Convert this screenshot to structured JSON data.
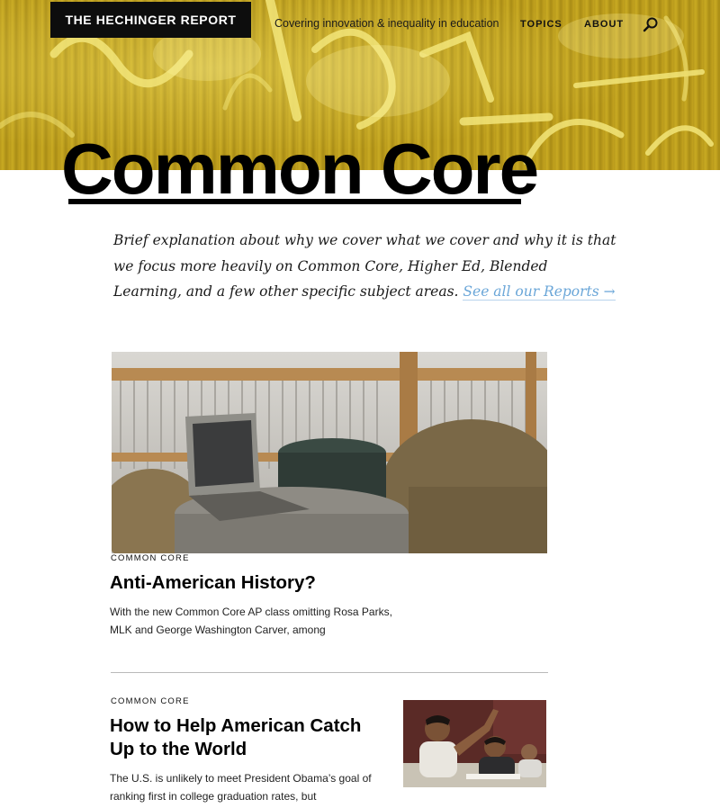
{
  "header": {
    "brand": "THE HECHINGER REPORT",
    "tagline": "Covering innovation & inequality in education",
    "nav": {
      "topics": "TOPICS",
      "about": "ABOUT"
    },
    "search_icon": "search-icon",
    "hero_color": "#c3a31e"
  },
  "page": {
    "title": "Common Core",
    "intro": "Brief explanation about why we cover what we cover and why it is that we focus more heavily on Common Core, Higher Ed, Blended Learning, and a few other specific subject areas.",
    "see_all_link": "See all our Reports →",
    "link_color": "#6aa6d8"
  },
  "articles": [
    {
      "kicker": "COMMON CORE",
      "headline": "Anti-American History?",
      "excerpt": "With the new Common Core AP class omitting Rosa Parks, MLK and George Washington Carver, among"
    },
    {
      "kicker": "COMMON CORE",
      "headline": "How to Help American Catch Up to the World",
      "excerpt": "The U.S. is unlikely to meet President Obama’s goal of ranking first in college graduation rates, but"
    }
  ]
}
